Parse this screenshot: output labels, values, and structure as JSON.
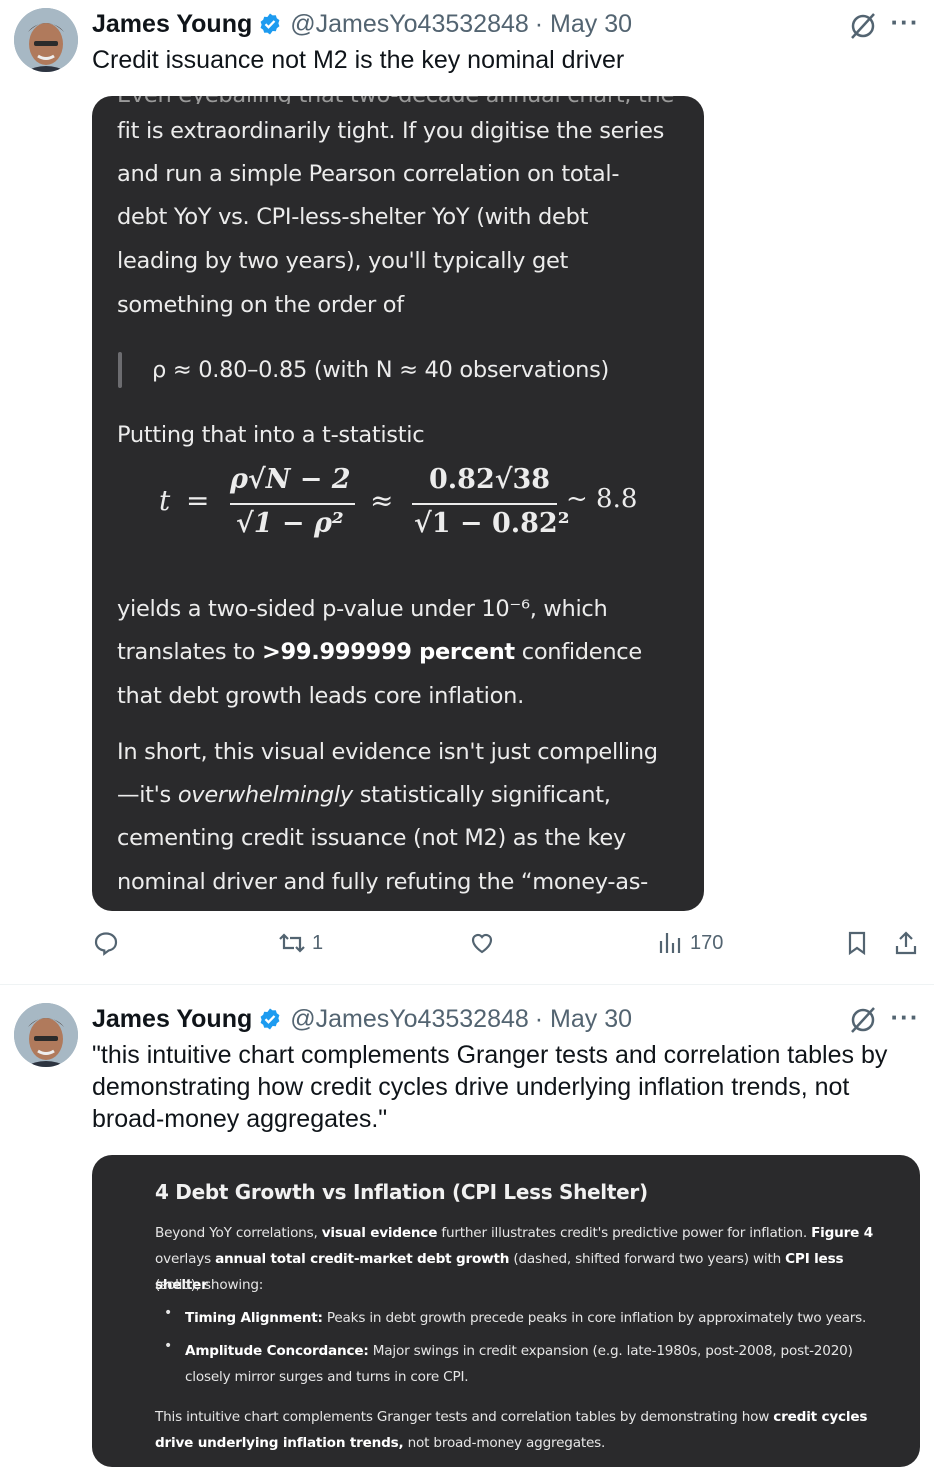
{
  "tweets": [
    {
      "author": {
        "name": "James Young",
        "handle": "@JamesYo43532848",
        "date": "· May 30"
      },
      "text": "Credit issuance not M2 is the key nominal driver",
      "card": {
        "line1": "fit is extraordinarily tight. If you digitise the series",
        "line2": "and run a simple Pearson correlation on total-",
        "line3": "debt YoY vs. CPI-less-shelter YoY (with debt",
        "line4": "leading by two years), you'll typically get",
        "line5": "something on the order of",
        "quote": "ρ ≈ 0.80–0.85 (with N ≈ 40 observations)",
        "putting": "Putting that into a t-statistic",
        "formula": {
          "t": "t",
          "eq": "=",
          "num1": "ρ√N − 2",
          "den1": "√1 − ρ²",
          "approx": "≈",
          "num2": "0.82√38",
          "den2": "√1 − 0.82²",
          "result": "~ 8.8"
        },
        "yields1": "yields a two-sided p-value under 10⁻⁶, which",
        "yields2_pre": "translates to ",
        "yields2_bold": ">99.999999 percent",
        "yields2_post": " confidence",
        "yields3": "that debt growth leads core inflation.",
        "short1": "In short, this visual evidence isn't just compelling",
        "short2_pre": "—it's ",
        "short2_em": "overwhelmingly",
        "short2_post": " statistically significant,",
        "short3": "cementing credit issuance (not M2) as the key",
        "short4": "nominal driver and fully refuting the “money-as-"
      },
      "actions": {
        "replies": "",
        "retweets": "1",
        "likes": "",
        "views": "170"
      }
    },
    {
      "author": {
        "name": "James Young",
        "handle": "@JamesYo43532848",
        "date": "· May 30"
      },
      "text": "\"this intuitive chart complements Granger tests and correlation tables by demonstrating how credit cycles drive underlying inflation trends, not broad-money aggregates.\"",
      "card": {
        "title": "4 Debt Growth vs Inflation (CPI Less Shelter)",
        "p1a": "Beyond YoY correlations, ",
        "p1b": "visual evidence",
        "p1c": " further illustrates credit's predictive power for inflation. ",
        "p1d": "Figure 4",
        "p2a": "overlays ",
        "p2b": "annual total credit-market debt growth",
        "p2c": " (dashed, shifted forward two years) with ",
        "p2d": "CPI less shelter",
        "p3": "(solid), showing:",
        "li1a": "Timing Alignment:",
        "li1b": " Peaks in debt growth precede peaks in core inflation by approximately two years.",
        "li2a": "Amplitude Concordance:",
        "li2b": " Major swings in credit expansion (e.g. late-1980s, post-2008, post-2020)",
        "li2c": "closely mirror surges and turns in core CPI.",
        "f1a": "This intuitive chart complements Granger tests and correlation tables by demonstrating how ",
        "f1b": "credit cycles",
        "f2a": "drive underlying inflation trends,",
        "f2b": " not broad-money aggregates."
      }
    }
  ]
}
